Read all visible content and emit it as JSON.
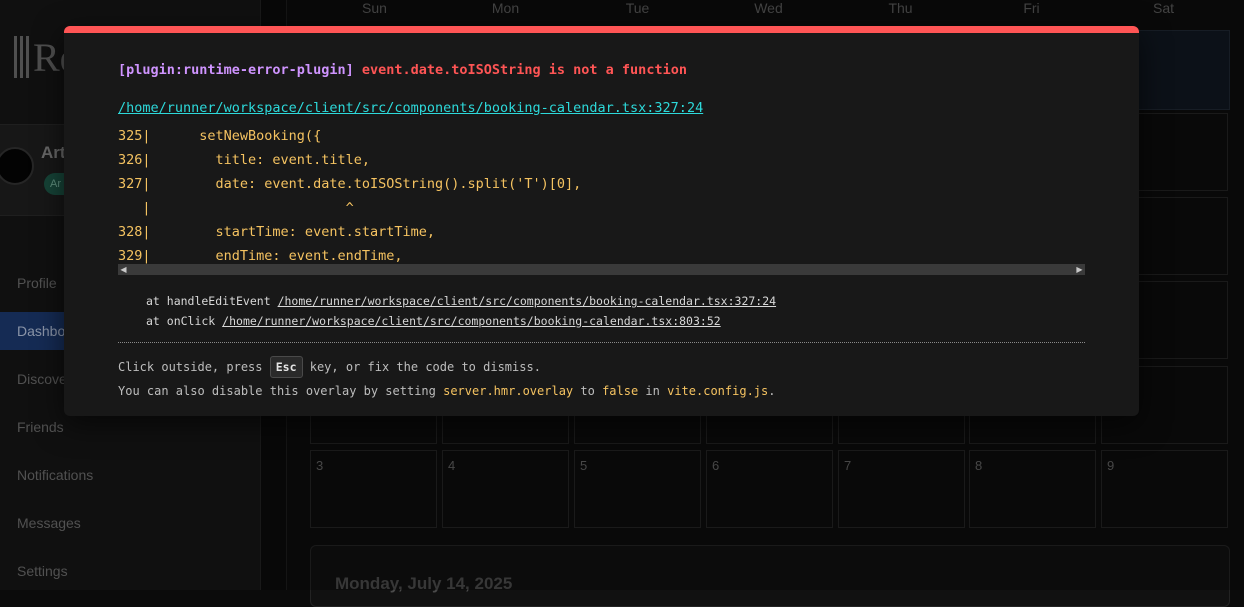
{
  "app": {
    "logo_text": "Re",
    "user": {
      "name": "Art",
      "badge": "Ar"
    },
    "nav": [
      "Profile",
      "Dashbo",
      "Discove",
      "Friends",
      "Notifications",
      "Messages",
      "Settings"
    ],
    "active_nav_index": 1
  },
  "calendar": {
    "weekdays": [
      "Sun",
      "Mon",
      "Tue",
      "Wed",
      "Thu",
      "Fri",
      "Sat"
    ],
    "last_row_days": [
      "3",
      "4",
      "5",
      "6",
      "7",
      "8",
      "9"
    ],
    "selected_date_title": "Monday, July 14, 2025"
  },
  "overlay": {
    "plugin": "[plugin:runtime-error-plugin]",
    "message": "event.date.toISOString is not a function",
    "file": "/home/runner/workspace/client/src/components/booking-calendar.tsx:327:24",
    "frame_lines": [
      "325|      setNewBooking({",
      "326|        title: event.title,",
      "327|        date: event.date.toISOString().split('T')[0],",
      "   |                        ^",
      "328|        startTime: event.startTime,",
      "329|        endTime: event.endTime,"
    ],
    "stack": [
      {
        "prefix": "at handleEditEvent ",
        "loc": "/home/runner/workspace/client/src/components/booking-calendar.tsx:327:24"
      },
      {
        "prefix": "at onClick ",
        "loc": "/home/runner/workspace/client/src/components/booking-calendar.tsx:803:52"
      }
    ],
    "tip1_before": "Click outside, press ",
    "tip1_key": "Esc",
    "tip1_after": " key, or fix the code to dismiss.",
    "tip2_a": "You can also disable this overlay by setting ",
    "tip2_b": "server.hmr.overlay",
    "tip2_c": " to ",
    "tip2_d": "false",
    "tip2_e": " in ",
    "tip2_f": "vite.config.js",
    "tip2_g": ".",
    "colors": {
      "border": "#ff5555",
      "plugin": "#cf94ff",
      "link": "#2dd9da",
      "code": "#f5c361"
    }
  }
}
